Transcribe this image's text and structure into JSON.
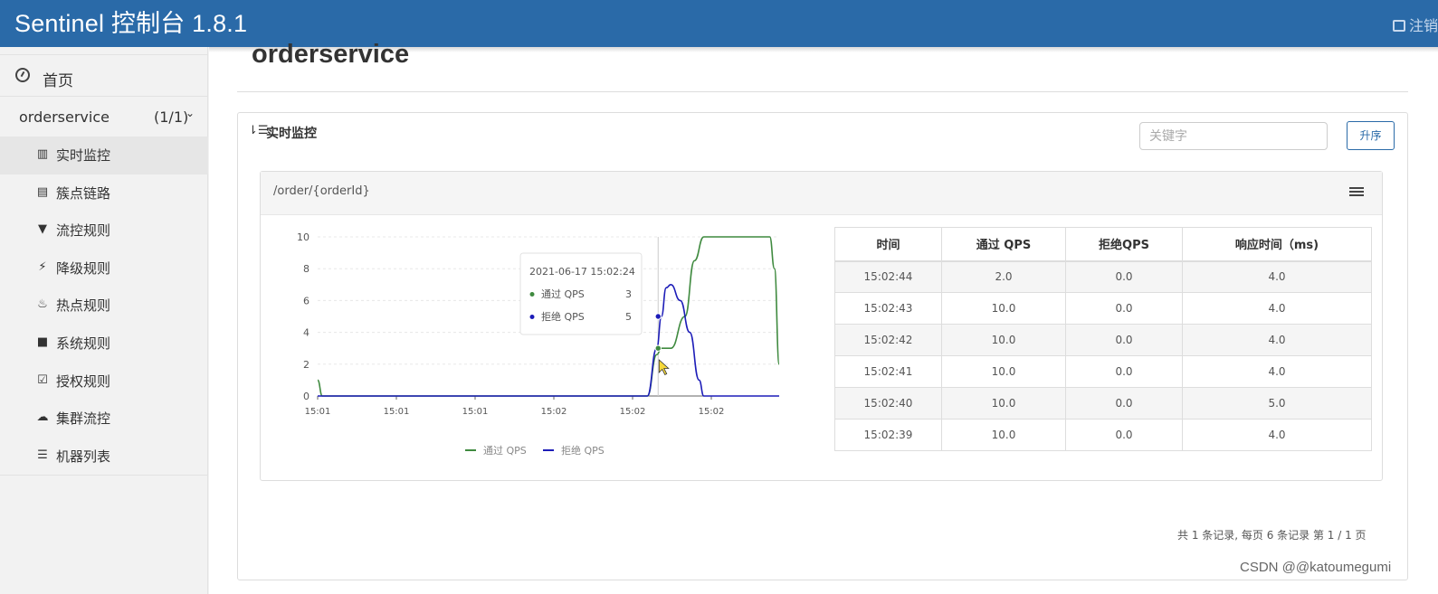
{
  "header": {
    "brand": "Sentinel 控制台 1.8.1",
    "logout_label": "注销"
  },
  "sidebar": {
    "home_label": "首页",
    "app": {
      "name": "orderservice",
      "count": "(1/1)"
    },
    "items": [
      {
        "label": "实时监控",
        "icon": "bar-chart-icon",
        "glyph": "▥",
        "active": true
      },
      {
        "label": "簇点链路",
        "icon": "list-alt-icon",
        "glyph": "▤",
        "active": false
      },
      {
        "label": "流控规则",
        "icon": "filter-icon",
        "glyph": "▼",
        "active": false
      },
      {
        "label": "降级规则",
        "icon": "flash-icon",
        "glyph": "⚡",
        "active": false
      },
      {
        "label": "热点规则",
        "icon": "fire-icon",
        "glyph": "♨",
        "active": false
      },
      {
        "label": "系统规则",
        "icon": "lock-icon",
        "glyph": "■",
        "active": false
      },
      {
        "label": "授权规则",
        "icon": "check-icon",
        "glyph": "☑",
        "active": false
      },
      {
        "label": "集群流控",
        "icon": "cloud-icon",
        "glyph": "☁",
        "active": false
      },
      {
        "label": "机器列表",
        "icon": "th-list-icon",
        "glyph": "☰",
        "active": false
      }
    ]
  },
  "main": {
    "page_title": "orderservice",
    "panel_title": "实时监控",
    "search_placeholder": "关键字",
    "sort_button": "升序",
    "resource_name": "/order/{orderId}",
    "pager_text": "共 1 条记录, 每页 6 条记录 第 1 / 1 页"
  },
  "table": {
    "headers": [
      "时间",
      "通过 QPS",
      "拒绝QPS",
      "响应时间（ms)"
    ],
    "rows": [
      [
        "15:02:44",
        "2.0",
        "0.0",
        "4.0"
      ],
      [
        "15:02:43",
        "10.0",
        "0.0",
        "4.0"
      ],
      [
        "15:02:42",
        "10.0",
        "0.0",
        "4.0"
      ],
      [
        "15:02:41",
        "10.0",
        "0.0",
        "4.0"
      ],
      [
        "15:02:40",
        "10.0",
        "0.0",
        "5.0"
      ],
      [
        "15:02:39",
        "10.0",
        "0.0",
        "4.0"
      ]
    ]
  },
  "chart_data": {
    "type": "line",
    "y_ticks": [
      0,
      2,
      4,
      6,
      8,
      10
    ],
    "ylim": [
      0,
      10
    ],
    "x_tick_labels": [
      "15:01",
      "15:01",
      "15:01",
      "15:02",
      "15:02",
      "15:02"
    ],
    "grid": true,
    "legend_position": "bottom-center",
    "series": [
      {
        "name": "通过 QPS",
        "color": "#3f8a3f",
        "points": [
          [
            0,
            1
          ],
          [
            1,
            0
          ],
          [
            20,
            0
          ],
          [
            40,
            0
          ],
          [
            60,
            0
          ],
          [
            70,
            0
          ],
          [
            72,
            2.6
          ],
          [
            73,
            3
          ],
          [
            75,
            3
          ],
          [
            78,
            5
          ],
          [
            80,
            8.5
          ],
          [
            82,
            10
          ],
          [
            94,
            10
          ],
          [
            96,
            10
          ],
          [
            97,
            8
          ],
          [
            98,
            2
          ]
        ]
      },
      {
        "name": "拒绝 QPS",
        "color": "#1d1db8",
        "points": [
          [
            0,
            0
          ],
          [
            20,
            0
          ],
          [
            40,
            0
          ],
          [
            60,
            0
          ],
          [
            70,
            0
          ],
          [
            72,
            3
          ],
          [
            73,
            5
          ],
          [
            74,
            6.8
          ],
          [
            75,
            7
          ],
          [
            77,
            6
          ],
          [
            79,
            4
          ],
          [
            81,
            1
          ],
          [
            82,
            0
          ],
          [
            98,
            0
          ]
        ]
      }
    ],
    "tooltip": {
      "title": "2021-06-17 15:02:24",
      "rows": [
        {
          "name": "通过 QPS",
          "value": "3",
          "color": "#3f8a3f"
        },
        {
          "name": "拒绝 QPS",
          "value": "5",
          "color": "#1d1db8"
        }
      ]
    }
  },
  "watermark": "CSDN @@katoumegumi"
}
